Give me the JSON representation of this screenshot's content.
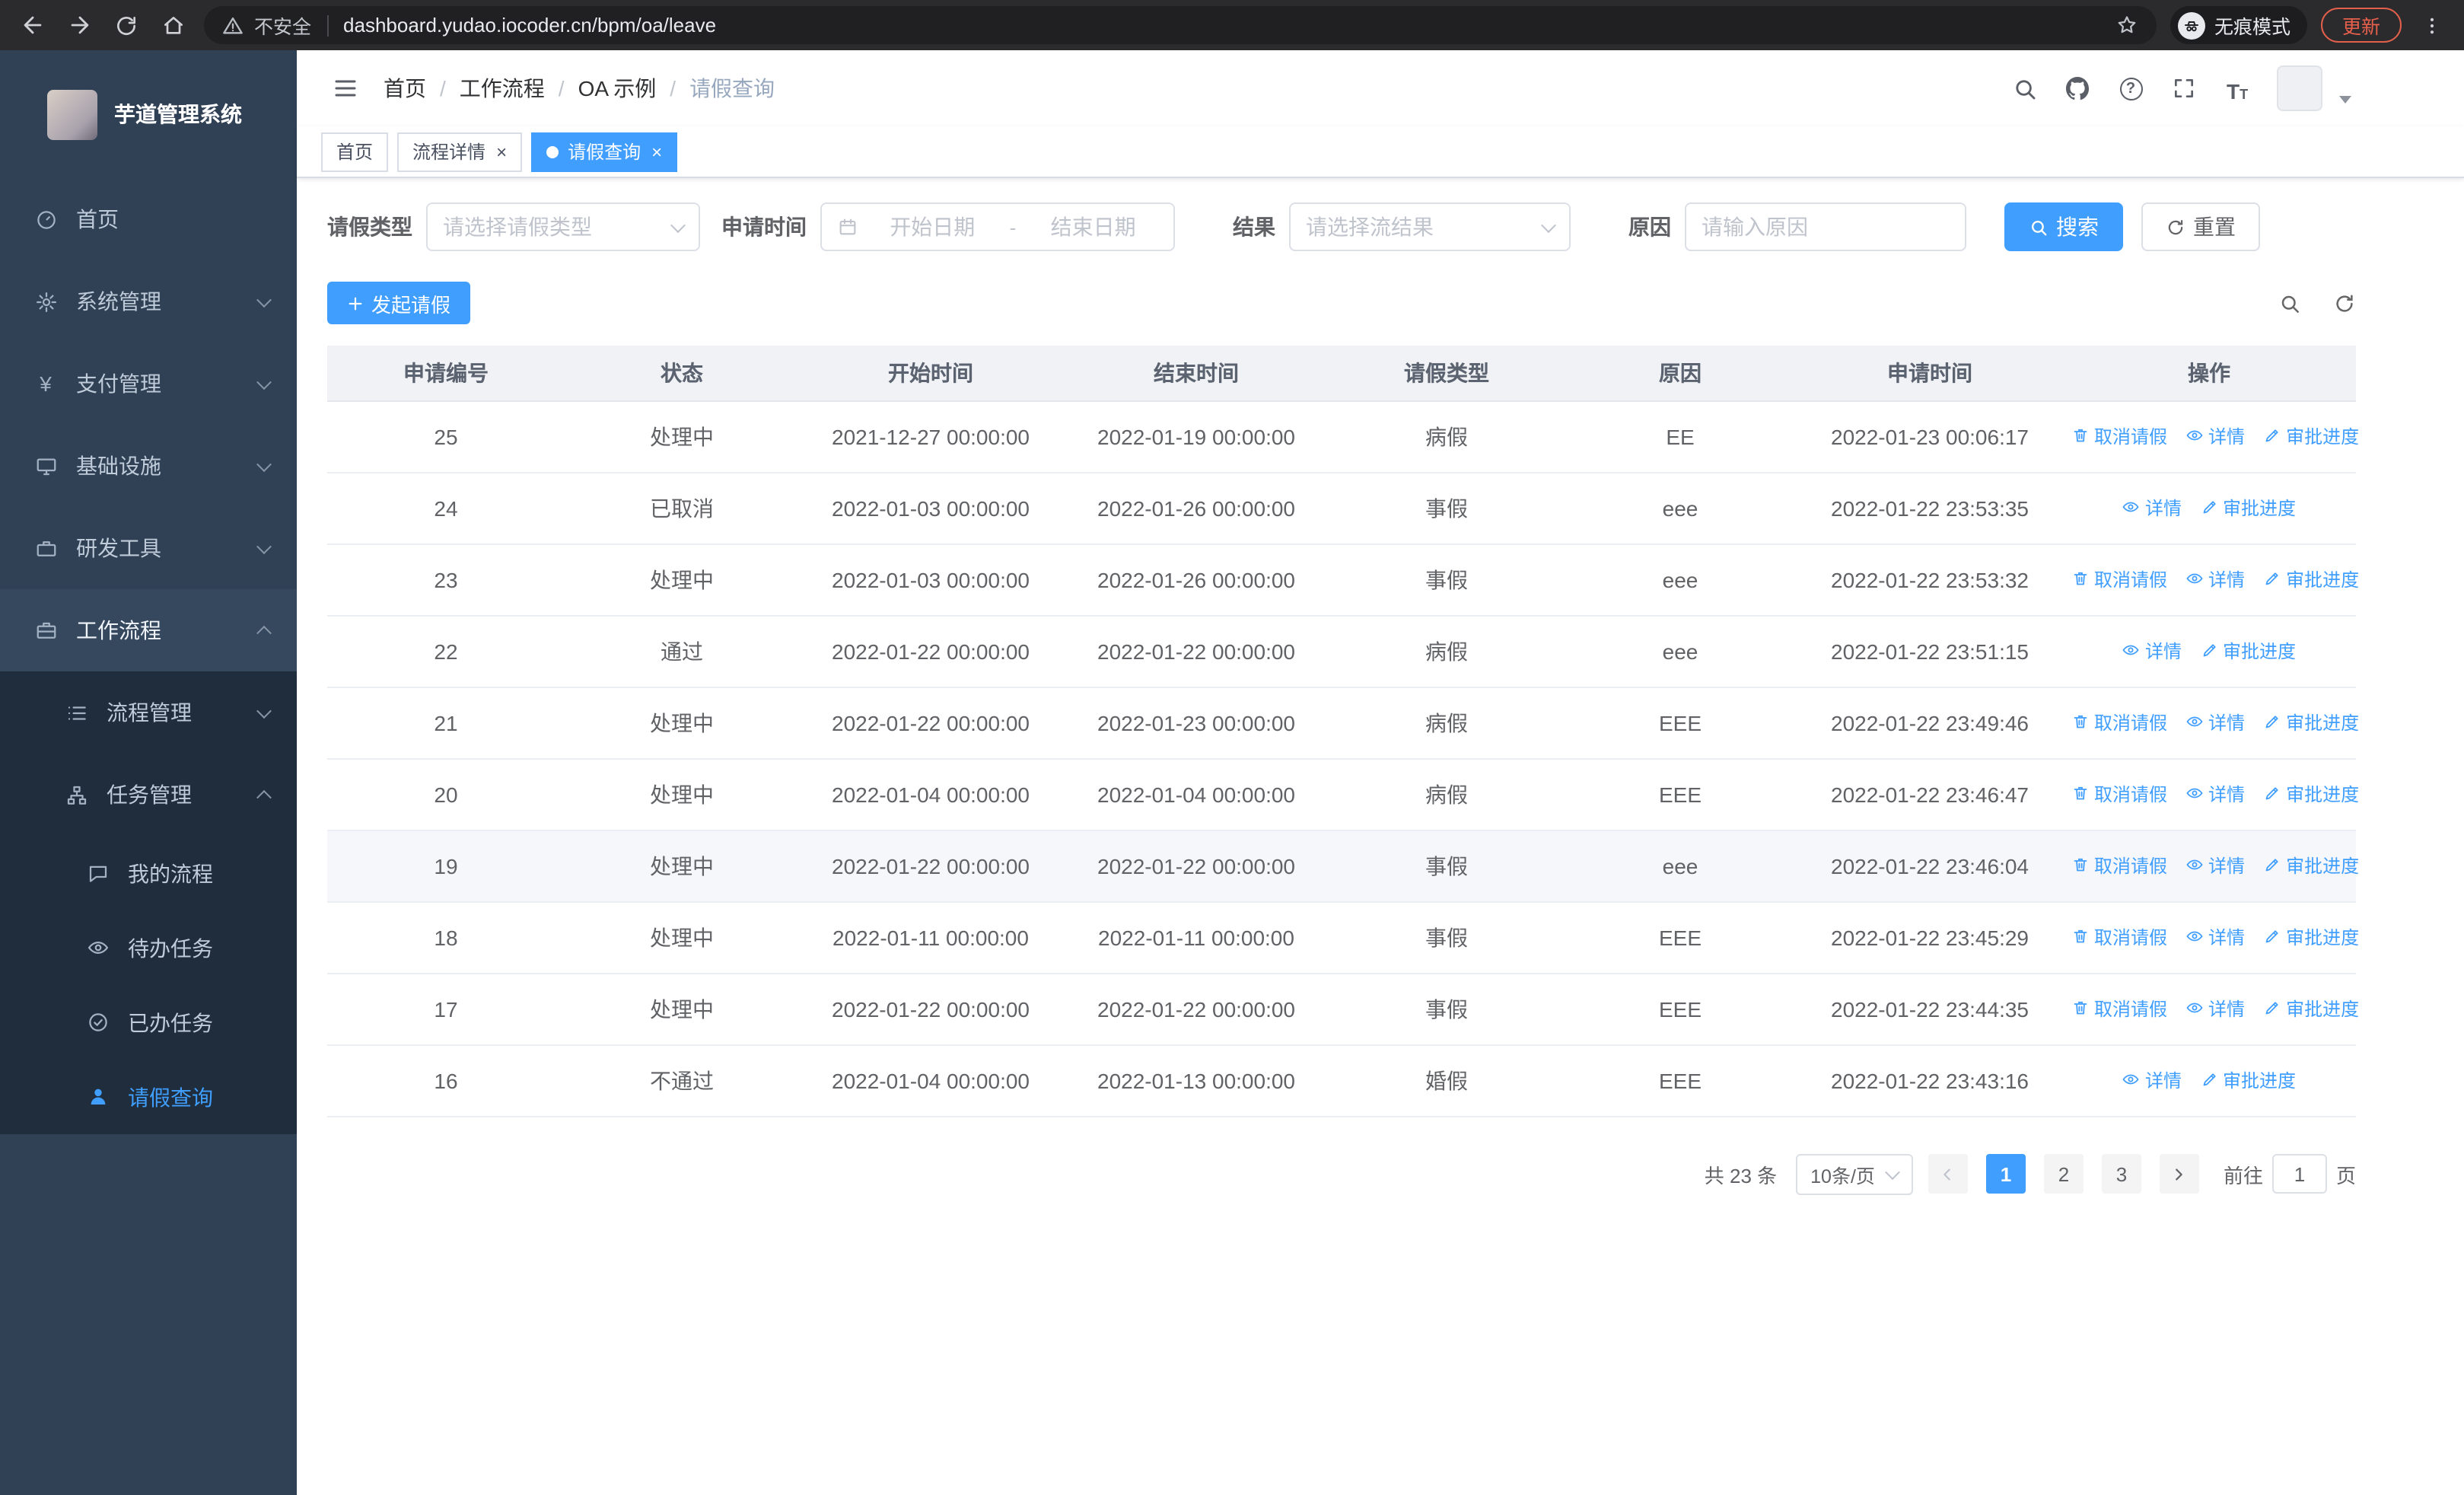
{
  "browser": {
    "security_label": "不安全",
    "url": "dashboard.yudao.iocoder.cn/bpm/oa/leave",
    "incognito_label": "无痕模式",
    "update_label": "更新"
  },
  "sidebar": {
    "logo_title": "芋道管理系统",
    "items": [
      {
        "label": "首页"
      },
      {
        "label": "系统管理"
      },
      {
        "label": "支付管理"
      },
      {
        "label": "基础设施"
      },
      {
        "label": "研发工具"
      },
      {
        "label": "工作流程"
      },
      {
        "label": "流程管理"
      },
      {
        "label": "任务管理"
      },
      {
        "label": "我的流程"
      },
      {
        "label": "待办任务"
      },
      {
        "label": "已办任务"
      },
      {
        "label": "请假查询"
      }
    ]
  },
  "header": {
    "separator": "/",
    "breadcrumb": [
      "首页",
      "工作流程",
      "OA 示例",
      "请假查询"
    ]
  },
  "tabs": [
    {
      "label": "首页"
    },
    {
      "label": "流程详情"
    },
    {
      "label": "请假查询"
    }
  ],
  "filters": {
    "leave_type_label": "请假类型",
    "leave_type_placeholder": "请选择请假类型",
    "apply_time_label": "申请时间",
    "start_date_placeholder": "开始日期",
    "range_separator": "-",
    "end_date_placeholder": "结束日期",
    "result_label": "结果",
    "result_placeholder": "请选择流结果",
    "reason_label": "原因",
    "reason_placeholder": "请输入原因",
    "search_label": "搜索",
    "reset_label": "重置"
  },
  "toolbar": {
    "create_label": "发起请假"
  },
  "table": {
    "columns": [
      "申请编号",
      "状态",
      "开始时间",
      "结束时间",
      "请假类型",
      "原因",
      "申请时间",
      "操作"
    ],
    "action_labels": {
      "cancel": "取消请假",
      "detail": "详情",
      "progress": "审批进度"
    },
    "rows": [
      {
        "id": "25",
        "status": "处理中",
        "start": "2021-12-27 00:00:00",
        "end": "2022-01-19 00:00:00",
        "type": "病假",
        "reason": "EE",
        "applied": "2022-01-23 00:06:17",
        "actions": [
          "cancel",
          "detail",
          "progress"
        ],
        "highlight": false
      },
      {
        "id": "24",
        "status": "已取消",
        "start": "2022-01-03 00:00:00",
        "end": "2022-01-26 00:00:00",
        "type": "事假",
        "reason": "eee",
        "applied": "2022-01-22 23:53:35",
        "actions": [
          "detail",
          "progress"
        ],
        "highlight": false
      },
      {
        "id": "23",
        "status": "处理中",
        "start": "2022-01-03 00:00:00",
        "end": "2022-01-26 00:00:00",
        "type": "事假",
        "reason": "eee",
        "applied": "2022-01-22 23:53:32",
        "actions": [
          "cancel",
          "detail",
          "progress"
        ],
        "highlight": false
      },
      {
        "id": "22",
        "status": "通过",
        "start": "2022-01-22 00:00:00",
        "end": "2022-01-22 00:00:00",
        "type": "病假",
        "reason": "eee",
        "applied": "2022-01-22 23:51:15",
        "actions": [
          "detail",
          "progress"
        ],
        "highlight": false
      },
      {
        "id": "21",
        "status": "处理中",
        "start": "2022-01-22 00:00:00",
        "end": "2022-01-23 00:00:00",
        "type": "病假",
        "reason": "EEE",
        "applied": "2022-01-22 23:49:46",
        "actions": [
          "cancel",
          "detail",
          "progress"
        ],
        "highlight": false
      },
      {
        "id": "20",
        "status": "处理中",
        "start": "2022-01-04 00:00:00",
        "end": "2022-01-04 00:00:00",
        "type": "病假",
        "reason": "EEE",
        "applied": "2022-01-22 23:46:47",
        "actions": [
          "cancel",
          "detail",
          "progress"
        ],
        "highlight": false
      },
      {
        "id": "19",
        "status": "处理中",
        "start": "2022-01-22 00:00:00",
        "end": "2022-01-22 00:00:00",
        "type": "事假",
        "reason": "eee",
        "applied": "2022-01-22 23:46:04",
        "actions": [
          "cancel",
          "detail",
          "progress"
        ],
        "highlight": true
      },
      {
        "id": "18",
        "status": "处理中",
        "start": "2022-01-11 00:00:00",
        "end": "2022-01-11 00:00:00",
        "type": "事假",
        "reason": "EEE",
        "applied": "2022-01-22 23:45:29",
        "actions": [
          "cancel",
          "detail",
          "progress"
        ],
        "highlight": false
      },
      {
        "id": "17",
        "status": "处理中",
        "start": "2022-01-22 00:00:00",
        "end": "2022-01-22 00:00:00",
        "type": "事假",
        "reason": "EEE",
        "applied": "2022-01-22 23:44:35",
        "actions": [
          "cancel",
          "detail",
          "progress"
        ],
        "highlight": false
      },
      {
        "id": "16",
        "status": "不通过",
        "start": "2022-01-04 00:00:00",
        "end": "2022-01-13 00:00:00",
        "type": "婚假",
        "reason": "EEE",
        "applied": "2022-01-22 23:43:16",
        "actions": [
          "detail",
          "progress"
        ],
        "highlight": false
      }
    ]
  },
  "pagination": {
    "total_label": "共 23 条",
    "page_size_label": "10条/页",
    "pages": [
      "1",
      "2",
      "3"
    ],
    "goto_label": "前往",
    "goto_value": "1",
    "goto_suffix": "页"
  }
}
